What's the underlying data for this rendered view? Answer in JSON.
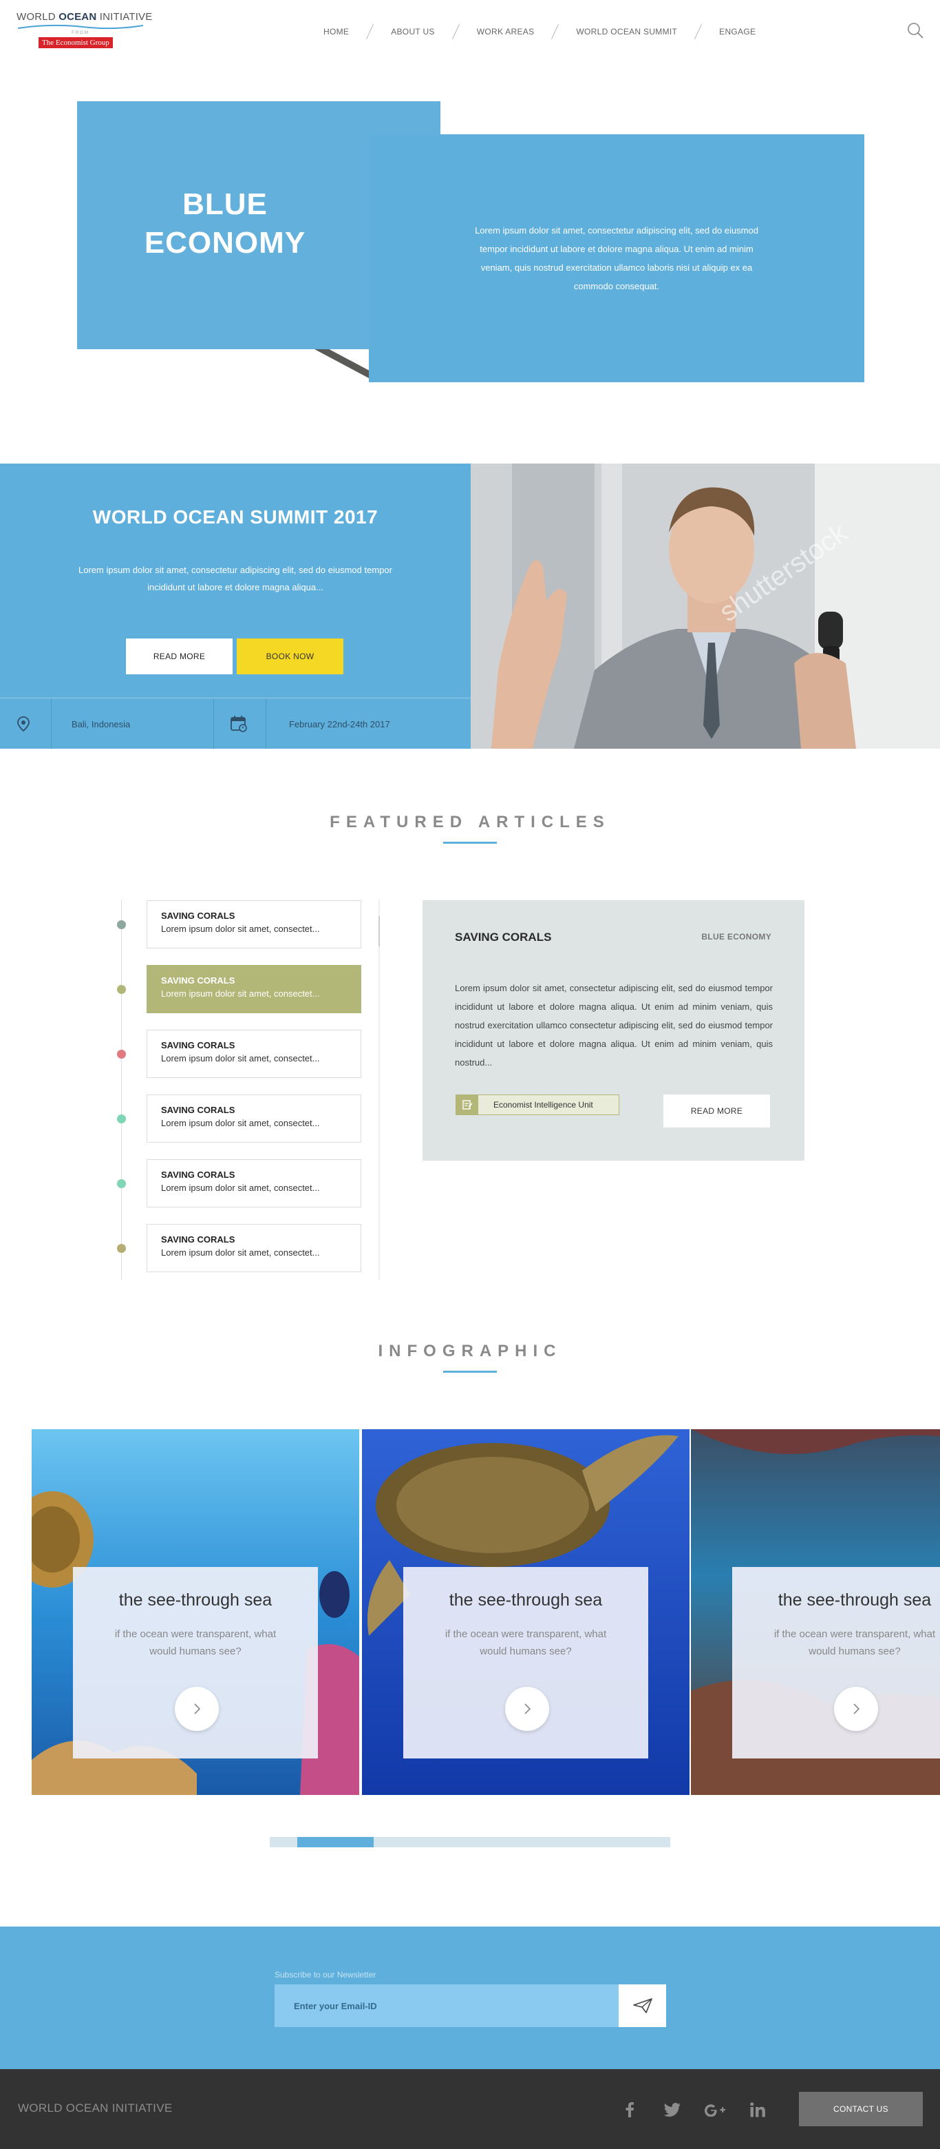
{
  "header": {
    "logo": {
      "brand_prefix": "WORLD ",
      "brand_bold": "OCEAN",
      "brand_suffix": " INITIATIVE",
      "from": "FROM",
      "group": "The Economist Group"
    },
    "nav": [
      "HOME",
      "ABOUT US",
      "WORK AREAS",
      "WORLD OCEAN SUMMIT",
      "ENGAGE"
    ],
    "search_icon": "search-icon"
  },
  "hero": {
    "title_line1": "BLUE",
    "title_line2": "ECONOMY",
    "text": "Lorem ipsum dolor sit amet, consectetur adipiscing elit, sed do eiusmod tempor incididunt ut labore et dolore magna aliqua. Ut enim ad minim veniam, quis nostrud exercitation ullamco laboris nisi ut aliquip ex ea commodo consequat."
  },
  "summit": {
    "title": "WORLD OCEAN SUMMIT 2017",
    "text": "Lorem ipsum dolor sit amet, consectetur adipiscing elit, sed do eiusmod tempor incididunt ut labore et dolore magna aliqua...",
    "read_more": "READ MORE",
    "book_now": "BOOK NOW",
    "location": "Bali, Indonesia",
    "date": "February 22nd-24th 2017",
    "photo_watermark": "shutterstock"
  },
  "featured": {
    "title": "FEATURED ARTICLES",
    "items": [
      {
        "title": "SAVING CORALS",
        "sub": "Lorem ipsum dolor sit amet, consectet...",
        "dot_color": "#8fa7a1"
      },
      {
        "title": "SAVING CORALS",
        "sub": "Lorem ipsum dolor sit amet, consectet...",
        "dot_color": "#b2b677"
      },
      {
        "title": "SAVING CORALS",
        "sub": "Lorem ipsum dolor sit amet, consectet...",
        "dot_color": "#e07a80"
      },
      {
        "title": "SAVING CORALS",
        "sub": "Lorem ipsum dolor sit amet, consectet...",
        "dot_color": "#7fd6b5"
      },
      {
        "title": "SAVING CORALS",
        "sub": "Lorem ipsum dolor sit amet, consectet...",
        "dot_color": "#7fd6b5"
      },
      {
        "title": "SAVING CORALS",
        "sub": "Lorem ipsum dolor sit amet, consectet...",
        "dot_color": "#b5ad72"
      }
    ],
    "active_index": 1,
    "detail": {
      "title": "SAVING CORALS",
      "tag": "BLUE ECONOMY",
      "text": "Lorem ipsum dolor sit amet, consectetur adipiscing elit, sed do eiusmod tempor incididunt ut labore et dolore magna aliqua. Ut enim ad minim veniam, quis nostrud exercitation ullamco consectetur adipiscing elit, sed do eiusmod tempor incididunt ut labore et dolore magna aliqua. Ut enim ad minim veniam, quis nostrud...",
      "source": "Economist Intelligence Unit",
      "read_more": "READ MORE"
    }
  },
  "infographic": {
    "title": "INFOGRAPHIC",
    "cards": [
      {
        "title": "the see-through sea",
        "text": "if the ocean were transparent, what would humans see?"
      },
      {
        "title": "the see-through sea",
        "text": "if the ocean were transparent, what would humans see?"
      },
      {
        "title": "the see-through sea",
        "text": "if the ocean were transparent, what would humans see?"
      }
    ],
    "progress": 0.19
  },
  "newsletter": {
    "label": "Subscribe to our Newsletter",
    "placeholder": "Enter your Email-ID"
  },
  "footer": {
    "brand": "WORLD OCEAN INITIATIVE",
    "social": [
      "facebook-icon",
      "twitter-icon",
      "google-plus-icon",
      "linkedin-icon"
    ],
    "contact": "CONTACT US"
  },
  "colors": {
    "accent": "#5eafdc",
    "olive": "#b2b677",
    "yellow": "#f5d823",
    "footer": "#333333"
  }
}
